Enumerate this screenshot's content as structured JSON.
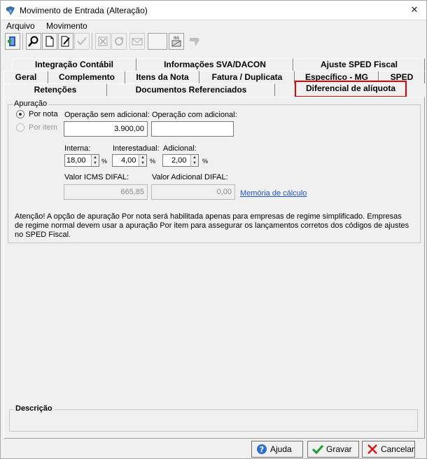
{
  "window": {
    "title": "Movimento de Entrada (Alteração)",
    "close_glyph": "✕"
  },
  "menu": {
    "items": [
      "Arquivo",
      "Movimento"
    ]
  },
  "toolbar": {
    "buttons": [
      "exit-icon",
      "search-icon",
      "new-document-icon",
      "edit-document-icon",
      "confirm-icon",
      "delete-icon",
      "refresh-icon",
      "mail-icon",
      "blank",
      "iss-icon",
      "undo-icon"
    ]
  },
  "tabs": {
    "row1": [
      "Integração Contábil",
      "Informações SVA/DACON",
      "Ajuste SPED Fiscal"
    ],
    "row2": [
      "Geral",
      "Complemento",
      "Itens da Nota",
      "Fatura / Duplicata",
      "Específico - MG",
      "SPED"
    ],
    "row3": [
      "Retenções",
      "Documentos Referenciados"
    ],
    "active": "Diferencial de alíquota"
  },
  "apuracao": {
    "group_label": "Apuração",
    "por_nota": "Por nota",
    "por_item": "Por item",
    "selected": "Por nota"
  },
  "fields": {
    "op_sem_adicional_label": "Operação sem adicional:",
    "op_sem_adicional_value": "3.900,00",
    "op_com_adicional_label": "Operação com adicional:",
    "op_com_adicional_value": "",
    "interna_label": "Interna:",
    "interna_value": "18,00",
    "interestadual_label": "Interestadual:",
    "interestadual_value": "4,00",
    "adicional_label": "Adicional:",
    "adicional_value": "2,00",
    "percent_symbol": "%",
    "valor_icms_difal_label": "Valor ICMS DIFAL:",
    "valor_icms_difal_value": "665,85",
    "valor_adicional_difal_label": "Valor Adicional DIFAL:",
    "valor_adicional_difal_value": "0,00",
    "memoria_link": "Memória de cálculo"
  },
  "notice": "Atenção! A opção de apuração Por nota será habilitada apenas para empresas de regime simplificado. Empresas de regime normal devem usar a apuração Por item para assegurar os lançamentos corretos dos códigos de ajustes no SPED Fiscal.",
  "descricao": {
    "label": "Descrição",
    "value": ""
  },
  "buttons": {
    "ajuda": "Ajuda",
    "gravar": "Gravar",
    "cancelar": "Cancelar"
  },
  "colors": {
    "active_tab_border": "#e00000",
    "link": "#1c52d1"
  }
}
